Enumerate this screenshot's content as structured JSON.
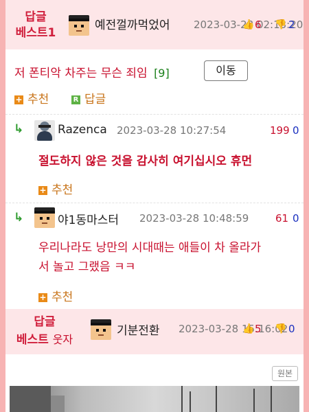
{
  "best_header": {
    "label_line1": "답글",
    "label_line2": "베스트1",
    "nickname": "예전껄까먹었어",
    "date": "2023-03-28 02:13:20",
    "up_count": "6",
    "down_count": "2"
  },
  "post": {
    "title": "저 폰티악 차주는 무슨 죄임",
    "comment_count": "[9]",
    "move_button": "이동",
    "recommend_label": "추천",
    "reply_label": "답글",
    "reply_icon": "R"
  },
  "replies": [
    {
      "nickname": "Razenca",
      "date": "2023-03-28 10:27:54",
      "up": "199",
      "down": "0",
      "text": "절도하지 않은 것을 감사히 여기십시오 휴먼",
      "recommend_label": "추천"
    },
    {
      "nickname": "야1동마스터",
      "date": "2023-03-28 10:48:59",
      "up": "61",
      "down": "0",
      "text_line1": "우리나라도 낭만의 시대때는 애들이 차 올라가",
      "text_line2": "서 놀고 그랬음 ㅋㅋ",
      "recommend_label": "추천"
    }
  ],
  "best_header2": {
    "label_line1": "답글",
    "label_line2": "베스트",
    "label_extra": "웃자",
    "nickname": "기분전환",
    "date": "2023-03-28 15:16:02",
    "up_count": "5",
    "down_count": "0"
  },
  "image_area": {
    "original_button": "원본"
  },
  "colors": {
    "accent_red": "#c8102e",
    "best_bg": "#fde6e8",
    "frame": "#f7b3b3"
  },
  "icons": {
    "reply_arrow": "↳",
    "plus": "+",
    "thumb_up": "👍",
    "thumb_down": "👎"
  }
}
